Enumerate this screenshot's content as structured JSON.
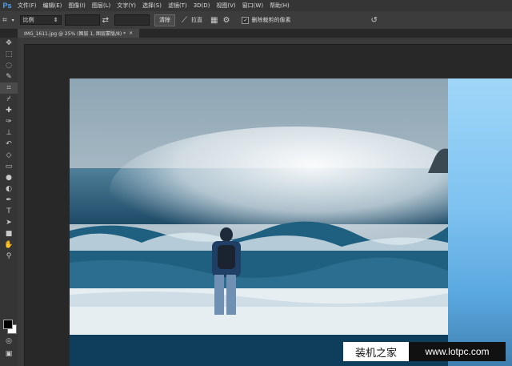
{
  "app": {
    "logo": "Ps"
  },
  "menu": [
    "文件(F)",
    "编辑(E)",
    "图像(I)",
    "图层(L)",
    "文字(Y)",
    "选择(S)",
    "滤镜(T)",
    "3D(D)",
    "视图(V)",
    "窗口(W)",
    "帮助(H)"
  ],
  "options": {
    "ratio_select": "比例",
    "clear_button": "清除",
    "straighten_label": "拉直",
    "delete_cropped_label": "删除裁剪的像素",
    "delete_cropped_checked": true
  },
  "document": {
    "tab_title": "IMG_1611.jpg @ 25% (图层 1, 图层蒙版/8) *"
  },
  "watermark": {
    "left": "装机之家",
    "right": "www.lotpc.com"
  },
  "colors": {
    "accent": "#4fa3f5",
    "canvas_bg": "#282828",
    "panel_bg": "#353535"
  },
  "tools": [
    "move-icon",
    "marquee-icon",
    "lasso-icon",
    "quick-select-icon",
    "crop-icon",
    "eyedropper-icon",
    "healing-icon",
    "brush-icon",
    "stamp-icon",
    "history-brush-icon",
    "eraser-icon",
    "gradient-icon",
    "blur-icon",
    "dodge-icon",
    "pen-icon",
    "type-icon",
    "path-select-icon",
    "shape-icon",
    "hand-icon",
    "zoom-icon"
  ]
}
